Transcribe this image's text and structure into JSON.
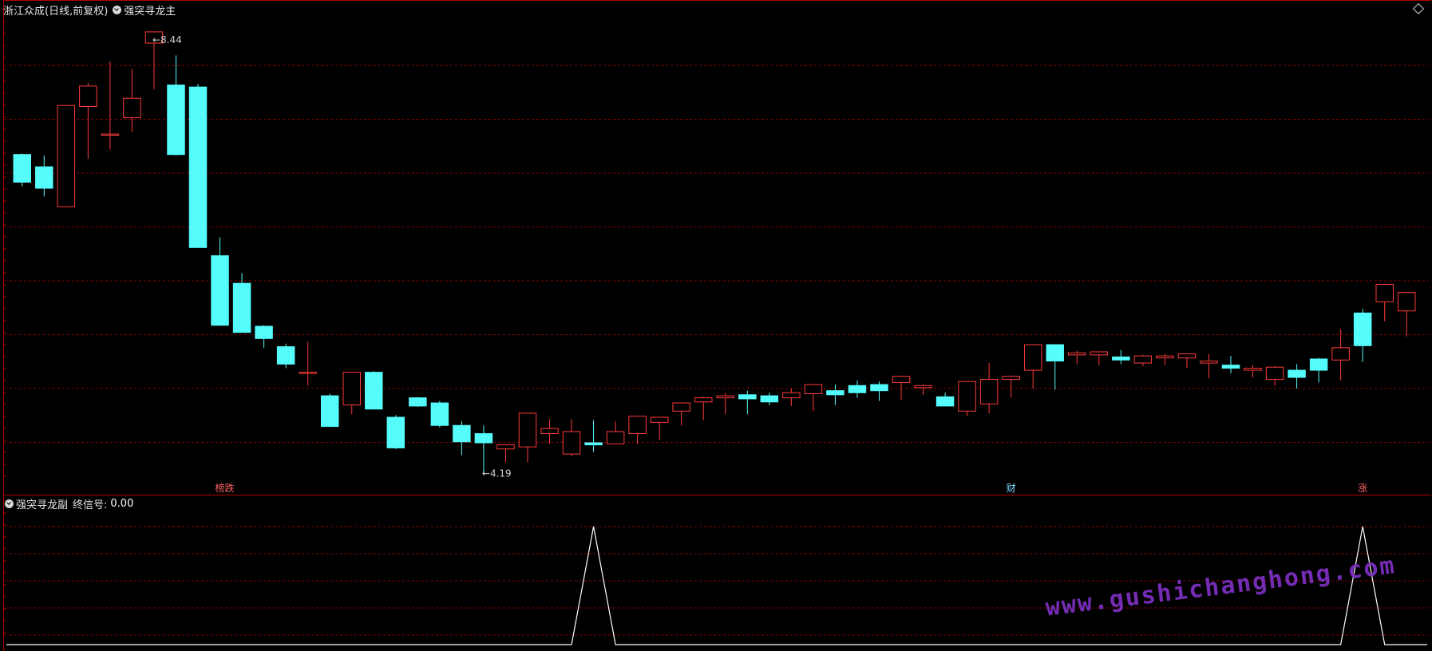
{
  "main_panel": {
    "stock_title": "浙江众成(日线,前复权)",
    "indicator_name": "强突寻龙主",
    "high_label": "8.44",
    "low_label": "4.19",
    "signal_label": "强突寻龙",
    "markers": [
      "榜跌",
      "财",
      "涨"
    ]
  },
  "sub_panel": {
    "indicator_name": "强突寻龙副",
    "signal_name": "终信号:",
    "signal_value": "0.00"
  },
  "watermark": "www.gushichanghong.com",
  "colors": {
    "up": "#ff3b3b",
    "down": "#54fcfc",
    "signal": "#ffff00",
    "grid": "#8a0000",
    "line": "#ffffff",
    "watermark": "#7b2fbe"
  },
  "chart_data": [
    {
      "type": "candlestick",
      "title": "强突寻龙主",
      "x": [
        1,
        2,
        3,
        4,
        5,
        6,
        7,
        8,
        9,
        10,
        11,
        12,
        13,
        14,
        15,
        16,
        17,
        18,
        19,
        20,
        21,
        22,
        23,
        24,
        25,
        26,
        27,
        28,
        29,
        30,
        31,
        32,
        33,
        34,
        35,
        36,
        37,
        38,
        39,
        40,
        41,
        42,
        43,
        44,
        45,
        46,
        47,
        48,
        49,
        50,
        51,
        52,
        53,
        54,
        55,
        56,
        57,
        58,
        59,
        60,
        61,
        62,
        63,
        64
      ],
      "open": [
        7.31,
        7.19,
        6.8,
        7.78,
        7.5,
        7.67,
        8.4,
        7.99,
        7.97,
        6.32,
        6.05,
        5.63,
        5.43,
        5.17,
        4.95,
        4.86,
        5.18,
        4.74,
        4.93,
        4.88,
        4.66,
        4.58,
        4.43,
        4.45,
        4.58,
        4.38,
        4.49,
        4.48,
        4.58,
        4.69,
        4.8,
        4.89,
        4.93,
        4.96,
        4.95,
        4.93,
        4.97,
        5.0,
        5.05,
        5.06,
        5.08,
        5.03,
        4.94,
        4.8,
        4.87,
        5.11,
        5.2,
        5.45,
        5.35,
        5.35,
        5.33,
        5.27,
        5.32,
        5.32,
        5.27,
        5.25,
        5.2,
        5.11,
        5.2,
        5.31,
        5.3,
        5.76,
        5.87,
        5.78
      ],
      "high": [
        7.32,
        7.3,
        7.58,
        8.01,
        8.22,
        8.15,
        8.44,
        8.28,
        8.0,
        6.5,
        6.15,
        5.64,
        5.46,
        5.48,
        4.97,
        5.02,
        5.19,
        4.76,
        4.94,
        4.9,
        4.7,
        4.66,
        4.46,
        4.48,
        4.72,
        4.72,
        4.71,
        4.7,
        4.68,
        4.74,
        4.82,
        4.94,
        4.98,
        5.0,
        4.98,
        5.02,
        5.0,
        5.06,
        5.1,
        5.09,
        5.14,
        5.06,
        4.98,
        4.97,
        5.27,
        5.15,
        5.44,
        5.45,
        5.39,
        5.37,
        5.4,
        5.35,
        5.36,
        5.35,
        5.36,
        5.34,
        5.25,
        5.24,
        5.26,
        5.32,
        5.6,
        5.8,
        6.0,
        5.89
      ],
      "low": [
        7.0,
        6.9,
        6.86,
        7.27,
        7.36,
        7.53,
        7.95,
        7.3,
        6.99,
        6.03,
        5.58,
        5.42,
        5.22,
        5.05,
        4.93,
        4.77,
        4.9,
        4.43,
        4.84,
        4.64,
        4.37,
        4.19,
        4.3,
        4.3,
        4.48,
        4.36,
        4.4,
        4.57,
        4.48,
        4.52,
        4.66,
        4.71,
        4.77,
        4.77,
        4.86,
        4.85,
        4.8,
        4.86,
        4.93,
        4.9,
        4.91,
        4.96,
        4.91,
        4.75,
        4.78,
        4.93,
        5.02,
        5.01,
        5.26,
        5.25,
        5.26,
        5.24,
        5.25,
        5.22,
        5.12,
        5.17,
        5.13,
        5.05,
        5.02,
        5.08,
        5.1,
        5.28,
        5.68,
        5.53
      ],
      "close": [
        7.04,
        6.98,
        7.79,
        7.98,
        7.51,
        7.86,
        8.51,
        7.31,
        6.4,
        5.64,
        5.57,
        5.51,
        5.26,
        5.18,
        4.65,
        5.18,
        4.82,
        4.44,
        4.85,
        4.66,
        4.5,
        4.49,
        4.47,
        4.78,
        4.63,
        4.6,
        4.47,
        4.6,
        4.75,
        4.74,
        4.88,
        4.93,
        4.95,
        4.92,
        4.89,
        4.98,
        5.06,
        4.96,
        4.98,
        5.0,
        5.14,
        5.05,
        4.85,
        5.09,
        5.11,
        5.14,
        5.45,
        5.29,
        5.37,
        5.38,
        5.3,
        5.34,
        5.34,
        5.36,
        5.29,
        5.22,
        5.22,
        5.23,
        5.13,
        5.2,
        5.42,
        5.44,
        6.04,
        5.96
      ],
      "ylim": [
        4.1,
        8.65
      ],
      "signals": [
        27,
        62
      ],
      "annotations": [
        "8.44",
        "4.19"
      ]
    },
    {
      "type": "line",
      "title": "强突寻龙副",
      "series": [
        {
          "name": "终信号",
          "values": [
            0,
            0,
            0,
            0,
            0,
            0,
            0,
            0,
            0,
            0,
            0,
            0,
            0,
            0,
            0,
            0,
            0,
            0,
            0,
            0,
            0,
            0,
            0,
            0,
            0,
            0,
            1,
            0,
            0,
            0,
            0,
            0,
            0,
            0,
            0,
            0,
            0,
            0,
            0,
            0,
            0,
            0,
            0,
            0,
            0,
            0,
            0,
            0,
            0,
            0,
            0,
            0,
            0,
            0,
            0,
            0,
            0,
            0,
            0,
            0,
            0,
            1,
            0,
            0
          ]
        }
      ],
      "ylim": [
        0,
        1
      ]
    }
  ]
}
